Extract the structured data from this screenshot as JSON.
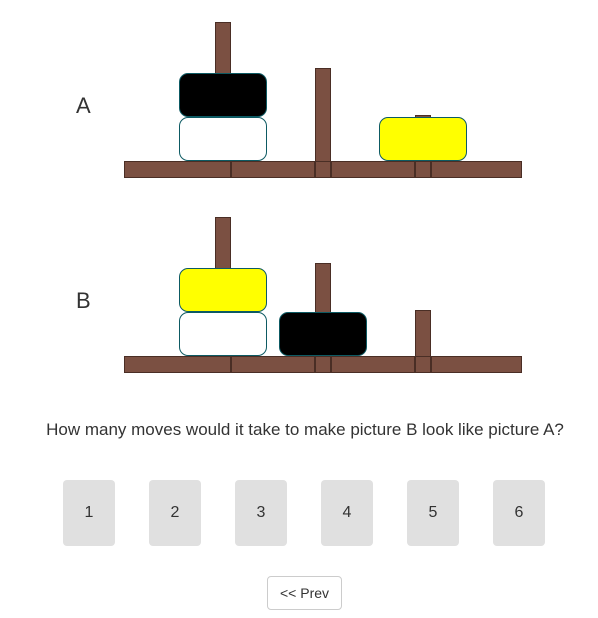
{
  "puzzles": [
    {
      "label": "A",
      "disk_colors": [
        "#000000",
        "#ffffff",
        "#ffff00"
      ],
      "pegs": [
        {
          "disks": [
            "white",
            "black"
          ]
        },
        {
          "disks": []
        },
        {
          "disks": [
            "yellow"
          ]
        }
      ]
    },
    {
      "label": "B",
      "pegs": [
        {
          "disks": [
            "white",
            "yellow"
          ]
        },
        {
          "disks": [
            "black"
          ]
        },
        {
          "disks": []
        }
      ]
    }
  ],
  "colors": {
    "wood": "#7b5042",
    "disk_border": "#0d5a63",
    "button_bg": "#e0e0e0"
  },
  "question": "How many moves would it take to make picture B look like picture A?",
  "answers": [
    "1",
    "2",
    "3",
    "4",
    "5",
    "6"
  ],
  "prev_label": "<< Prev"
}
